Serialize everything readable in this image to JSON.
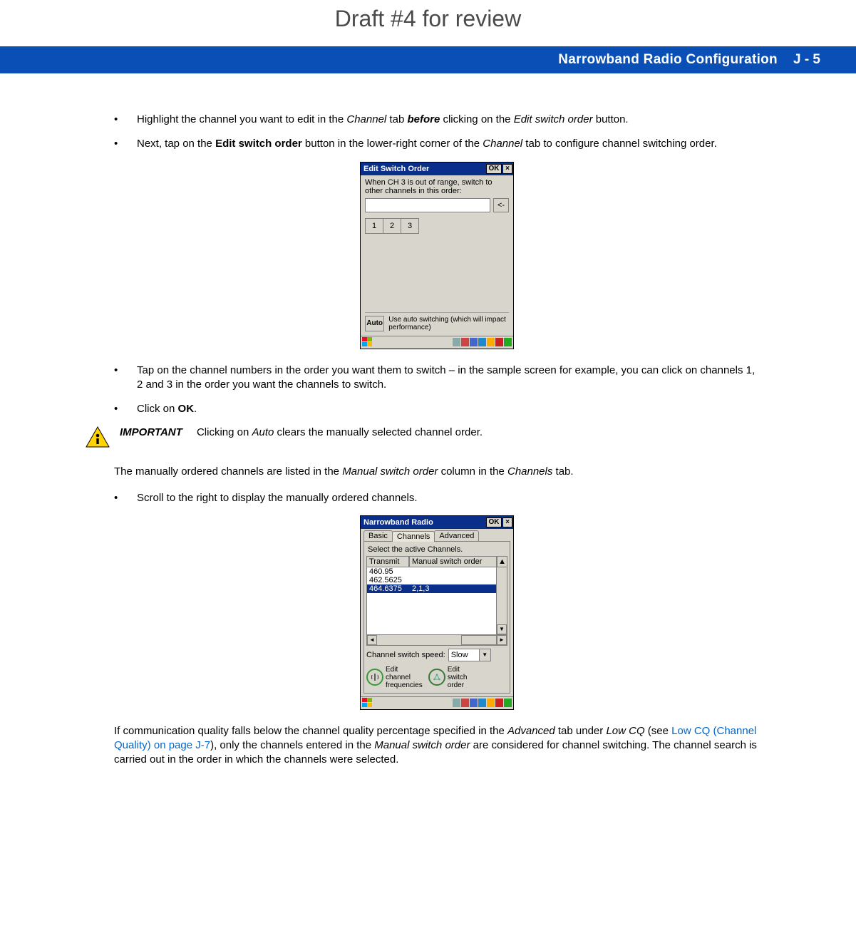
{
  "draft_title": "Draft #4 for review",
  "header": {
    "title": "Narrowband Radio Configuration",
    "page": "J - 5"
  },
  "bullets_top": [
    {
      "pre": "Highlight the channel you want to edit in the ",
      "em1": "Channel",
      "mid1": " tab ",
      "bem": "before",
      "mid2": " clicking on the ",
      "em2": "Edit switch order",
      "post": " button."
    },
    {
      "pre": "Next, tap on the ",
      "b1": "Edit switch order",
      "mid1": " button in the lower-right corner of the ",
      "em1": "Channel",
      "post": " tab to configure channel switching order."
    }
  ],
  "win1": {
    "title": "Edit Switch Order",
    "ok": "OK",
    "close": "×",
    "msg": "When CH 3 is out of range, switch to other channels in this order:",
    "back": "<-",
    "nums": [
      "1",
      "2",
      "3"
    ],
    "auto": "Auto",
    "autotext": "Use auto switching (which will impact performance)"
  },
  "bullets_mid": [
    "Tap on the channel numbers in the order you want them to switch – in the sample screen for example, you can click on channels 1, 2 and 3 in the order you want the channels to switch.",
    "Click on OK."
  ],
  "important": {
    "label": "IMPORTANT",
    "pre": "Clicking on ",
    "em": "Auto",
    "post": " clears the manually selected channel order."
  },
  "para1": {
    "pre": "The manually ordered channels are listed in the ",
    "em1": "Manual switch order",
    "mid": " column in the ",
    "em2": "Channels",
    "post": " tab."
  },
  "bullet_scroll": "Scroll to the right to display the manually ordered channels.",
  "win2": {
    "title": "Narrowband Radio",
    "ok": "OK",
    "close": "×",
    "tabs": [
      "Basic",
      "Channels",
      "Advanced"
    ],
    "subtitle": "Select the active Channels.",
    "cols": [
      "Transmit",
      "Manual switch order"
    ],
    "rows": [
      {
        "t": "460.95",
        "m": ""
      },
      {
        "t": "462.5625",
        "m": ""
      },
      {
        "t": "464.6375",
        "m": "2,1,3"
      }
    ],
    "speed_label": "Channel switch speed:",
    "speed_value": "Slow",
    "edit_freq": "Edit\nchannel\nfrequencies",
    "edit_switch": "Edit\nswitch\norder"
  },
  "para2": {
    "pre": "If communication quality falls below the channel quality percentage specified in the ",
    "em1": "Advanced",
    "mid1": " tab under ",
    "em2": "Low CQ",
    "mid2": " (see ",
    "link": "Low CQ (Channel Quality) on page J-7",
    "mid3": "), only the channels entered in the ",
    "em3": "Manual switch order",
    "post": " are considered for channel switching. The channel search is carried out in the order in which the channels were selected."
  }
}
